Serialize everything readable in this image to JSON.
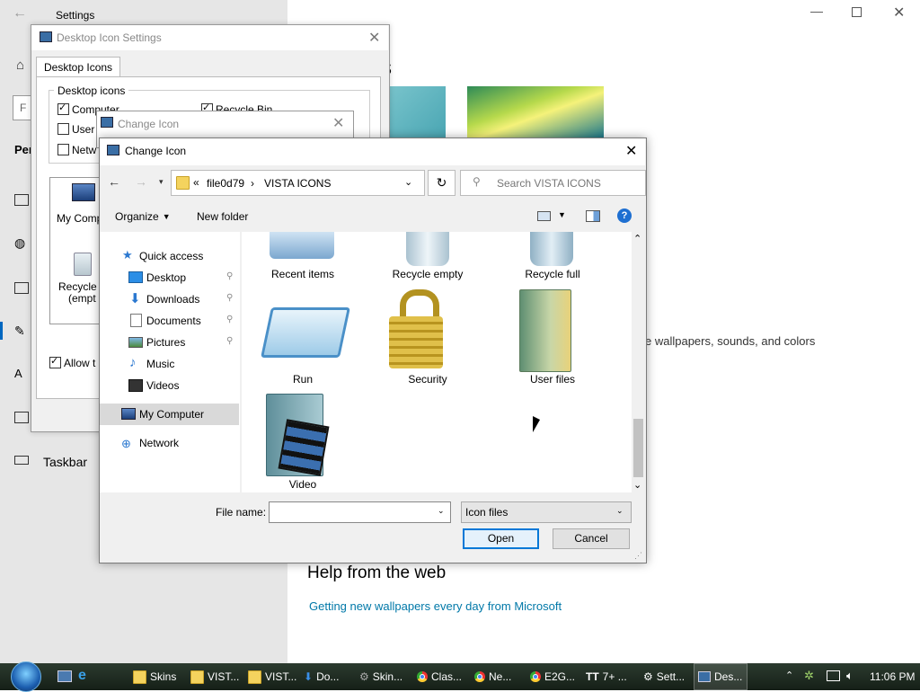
{
  "settings": {
    "title": "Settings",
    "heading_fragment": "s",
    "description_fragment": "e wallpapers, sounds, and colors",
    "help_heading": "Help from the web",
    "help_link": "Getting new wallpapers every day from Microsoft",
    "sidebar_left": {
      "search_fragment": "F",
      "section_fragment": "Per",
      "taskbar_label": "Taskbar"
    }
  },
  "desktop_icon_settings": {
    "title": "Desktop Icon Settings",
    "tab": "Desktop Icons",
    "group_label": "Desktop icons",
    "checkboxes": [
      {
        "label": "Computer",
        "checked": true
      },
      {
        "label": "Recycle Bin",
        "checked": true
      },
      {
        "label": "User",
        "checked": false
      },
      {
        "label": "Netw",
        "checked": false
      }
    ],
    "icons": [
      {
        "label": "My Comp"
      },
      {
        "label": "Recycle",
        "sub": "(empt"
      }
    ],
    "allow_label": "Allow t",
    "allow_checked": true
  },
  "change_icon_back": {
    "title": "Change Icon"
  },
  "dialog": {
    "title": "Change Icon",
    "breadcrumb": [
      "file0d79",
      "VISTA ICONS"
    ],
    "breadcrumb_prefix": "«",
    "search_placeholder": "Search VISTA ICONS",
    "organize_label": "Organize",
    "new_folder_label": "New folder",
    "nav": {
      "quick_access": "Quick access",
      "items": [
        {
          "label": "Desktop",
          "pinned": true
        },
        {
          "label": "Downloads",
          "pinned": true
        },
        {
          "label": "Documents",
          "pinned": true
        },
        {
          "label": "Pictures",
          "pinned": true
        },
        {
          "label": "Music",
          "pinned": false
        },
        {
          "label": "Videos",
          "pinned": false
        }
      ],
      "my_computer": "My Computer",
      "network": "Network"
    },
    "files": [
      {
        "label": "Recent items"
      },
      {
        "label": "Recycle empty"
      },
      {
        "label": "Recycle full"
      },
      {
        "label": "Run"
      },
      {
        "label": "Security"
      },
      {
        "label": "User files"
      },
      {
        "label": "Video"
      }
    ],
    "file_name_label": "File name:",
    "file_name_value": "",
    "file_type": "Icon files",
    "open_label": "Open",
    "cancel_label": "Cancel"
  },
  "taskbar": {
    "items": [
      {
        "label": "Skins",
        "icon": "folder-icon"
      },
      {
        "label": "VIST...",
        "icon": "folder-icon"
      },
      {
        "label": "VIST...",
        "icon": "folder-icon"
      },
      {
        "label": "Do...",
        "icon": "download-icon"
      },
      {
        "label": "Skin...",
        "icon": "app-icon"
      },
      {
        "label": "Clas...",
        "icon": "chrome-icon"
      },
      {
        "label": "Ne...",
        "icon": "chrome-icon"
      },
      {
        "label": "E2G...",
        "icon": "chrome-icon"
      },
      {
        "label": "7+ ...",
        "icon": "app-icon"
      },
      {
        "label": "Sett...",
        "icon": "gear-icon"
      },
      {
        "label": "Des...",
        "icon": "desktop-icon"
      }
    ],
    "time": "11:06 PM"
  },
  "colors": {
    "accent": "#0067c0",
    "link": "#0078a8",
    "taskbar": "#1b2a1e",
    "selected_nav": "#d9d9d9"
  }
}
